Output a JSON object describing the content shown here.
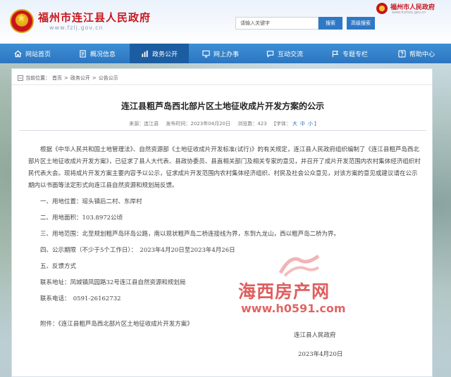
{
  "header": {
    "site_title": "福州市连江县人民政府",
    "site_domain": "www.fzlj.gov.cn",
    "search_placeholder": "请输入关键字",
    "search_button": "搜索",
    "advanced_search_button": "高级搜索",
    "city_logo_name": "福州市人民政府",
    "city_logo_url": "www.fuzhou.gov.cn"
  },
  "nav": {
    "items": [
      {
        "label": "网站首页",
        "icon": "home-icon"
      },
      {
        "label": "概况信息",
        "icon": "document-icon"
      },
      {
        "label": "政务公开",
        "icon": "bar-chart-icon"
      },
      {
        "label": "网上办事",
        "icon": "monitor-icon"
      },
      {
        "label": "互动交流",
        "icon": "chat-icon"
      },
      {
        "label": "专题专栏",
        "icon": "flag-icon"
      },
      {
        "label": "帮助中心",
        "icon": "help-icon"
      }
    ],
    "active_index": 2
  },
  "breadcrumb": {
    "prefix": "当前位置：",
    "items": [
      "首页",
      "政务公开",
      "公告公示"
    ],
    "separator": " > "
  },
  "article": {
    "title": "连江县粗芦岛西北部片区土地征收成片开发方案的公示",
    "meta": {
      "source": "来源：连江县",
      "date": "发布时间：2023年04月20日",
      "views": "浏览数：423",
      "font_prefix": "【字体：",
      "font_large": "大",
      "font_medium": "中",
      "font_small": "小",
      "font_suffix": "】"
    },
    "intro": "根据《中华人民共和国土地管理法》、自然资源部《土地征收成片开发标准(试行)》的有关规定，连江县人民政府组织编制了《连江县粗芦岛西北部片区土地征收成片开发方案》，已征求了县人大代表、县政协委员、县直相关部门及相关专家的意见，并召开了成片开发范围内农村集体经济组织村民代表大会。现将成片开发方案主要内容予以公示，征求成片开发范围内农村集体经济组织、村民及社会公众意见，对该方案的意见或建议请在公示期内以书面等法定形式向连江县自然资源和规划局反馈。",
    "items": [
      "一、用地位置：琯头镇后二村、东岸村",
      "二、用地面积：103.8972公顷",
      "三、用地范围：北至规划粗芦岛环岛公路，南以现状粗芦岛二桥连接线为界，东到九龙山，西以粗芦岛二桥为界。",
      "四、公示期限（不少于5个工作日）：　2023年4月20日至2023年4月26日",
      "五、反馈方式",
      "联系地址：凤城镇凤园路32号连江县自然资源和规划局",
      "联系电话：　0591-26162732"
    ],
    "attachment": "附件：《连江县粗芦岛西北部片区土地征收成片开发方案》",
    "signature_org": "连江县人民政府",
    "signature_date": "2023年4月20日"
  },
  "watermark": {
    "name": "海西房产网",
    "url": "www.h0591.com"
  },
  "colors": {
    "nav_bg": "#2c76bf",
    "nav_active": "#1c5da1",
    "brand_red": "#c8161d",
    "watermark_red": "#d62828"
  }
}
